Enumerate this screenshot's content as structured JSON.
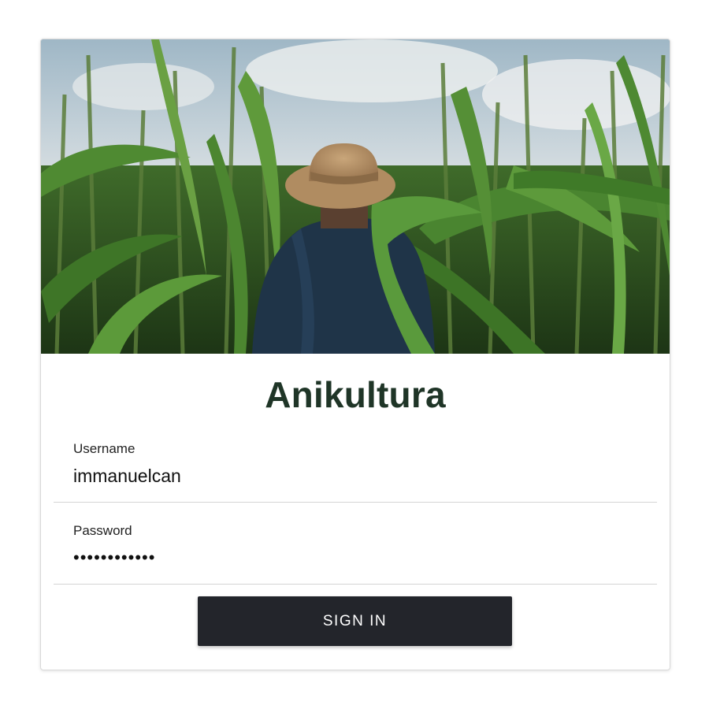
{
  "app": {
    "title": "Anikultura"
  },
  "hero": {
    "image_subject": "farmer in straw hat standing in a cornfield"
  },
  "form": {
    "username": {
      "label": "Username",
      "value": "immanuelcan"
    },
    "password": {
      "label": "Password",
      "value": "••••••••••••"
    },
    "submit_label": "SIGN IN"
  },
  "colors": {
    "title": "#1f3527",
    "button_bg": "#23252b",
    "button_text": "#ffffff",
    "divider": "#d4d4d4"
  }
}
